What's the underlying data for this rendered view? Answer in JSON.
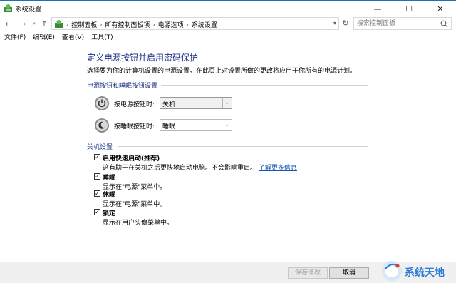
{
  "window": {
    "title": "系统设置",
    "controls": {
      "minimize": "—",
      "maximize": "☐",
      "close": "✕"
    }
  },
  "address": {
    "crumbs": [
      "控制面板",
      "所有控制面板项",
      "电源选项",
      "系统设置"
    ],
    "search_placeholder": "搜索控制面板"
  },
  "menu": [
    "文件(F)",
    "编辑(E)",
    "查看(V)",
    "工具(T)"
  ],
  "page": {
    "title": "定义电源按钮并启用密码保护",
    "intro": "选择要为你的计算机设置的电源设置。在此页上对设置所做的更改将应用于你所有的电源计划。"
  },
  "power_section": {
    "heading": "电源按钮和睡眠按钮设置",
    "rows": [
      {
        "label": "按电源按钮时:",
        "value": "关机",
        "icon": "power-icon"
      },
      {
        "label": "按睡眠按钮时:",
        "value": "睡眠",
        "icon": "sleep-icon"
      }
    ]
  },
  "shutdown_section": {
    "heading": "关机设置",
    "options": [
      {
        "title": "启用快速启动(推荐)",
        "desc": "这有助于在关机之后更快地启动电脑。不会影响重启。",
        "link": "了解更多信息",
        "checked": true
      },
      {
        "title": "睡眠",
        "desc": "显示在\"电源\"菜单中。",
        "checked": true
      },
      {
        "title": "休眠",
        "desc": "显示在\"电源\"菜单中。",
        "checked": true
      },
      {
        "title": "锁定",
        "desc": "显示在用户头像菜单中。",
        "checked": true
      }
    ]
  },
  "footer": {
    "save": "保存修改",
    "cancel": "取消"
  },
  "watermark": {
    "text": "系统天地"
  },
  "colors": {
    "title_blue": "#1e3287",
    "link_blue": "#1556b5",
    "watermark_blue": "#2e7bd6"
  }
}
